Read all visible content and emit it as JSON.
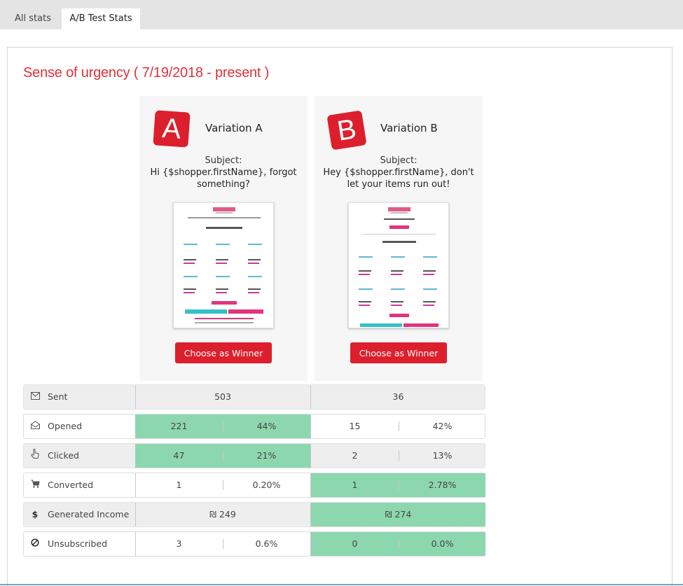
{
  "tabs": [
    {
      "label": "All stats"
    },
    {
      "label": "A/B Test Stats"
    }
  ],
  "test_title": "Sense of urgency ( 7/19/2018 - present )",
  "variations": [
    {
      "letter": "A",
      "name": "Variation A",
      "subject_label": "Subject:",
      "subject": "Hi {$shopper.firstName}, forgot something?",
      "winner_label": "Choose as Winner"
    },
    {
      "letter": "B",
      "name": "Variation B",
      "subject_label": "Subject:",
      "subject": "Hey {$shopper.firstName}, don't let your items run out!",
      "winner_label": "Choose as Winner"
    }
  ],
  "stats": {
    "sent": {
      "label": "Sent",
      "icon": "envelope-icon",
      "a": "503",
      "b": "36"
    },
    "opened": {
      "label": "Opened",
      "icon": "envelope-open-icon",
      "a_count": "221",
      "a_pct": "44%",
      "b_count": "15",
      "b_pct": "42%"
    },
    "clicked": {
      "label": "Clicked",
      "icon": "hand-pointer-icon",
      "a_count": "47",
      "a_pct": "21%",
      "b_count": "2",
      "b_pct": "13%"
    },
    "converted": {
      "label": "Converted",
      "icon": "cart-icon",
      "a_count": "1",
      "a_pct": "0.20%",
      "b_count": "1",
      "b_pct": "2.78%"
    },
    "income": {
      "label": "Generated Income",
      "icon": "dollar-icon",
      "a": "₪ 249",
      "b": "₪ 274"
    },
    "unsubscribed": {
      "label": "Unsubscribed",
      "icon": "ban-icon",
      "a_count": "3",
      "a_pct": "0.6%",
      "b_count": "0",
      "b_pct": "0.0%"
    }
  },
  "colors": {
    "accent": "#dd1f2d",
    "title": "#e0313b",
    "winner_highlight": "#8dd7ae",
    "row_gray": "#eeeeee"
  }
}
